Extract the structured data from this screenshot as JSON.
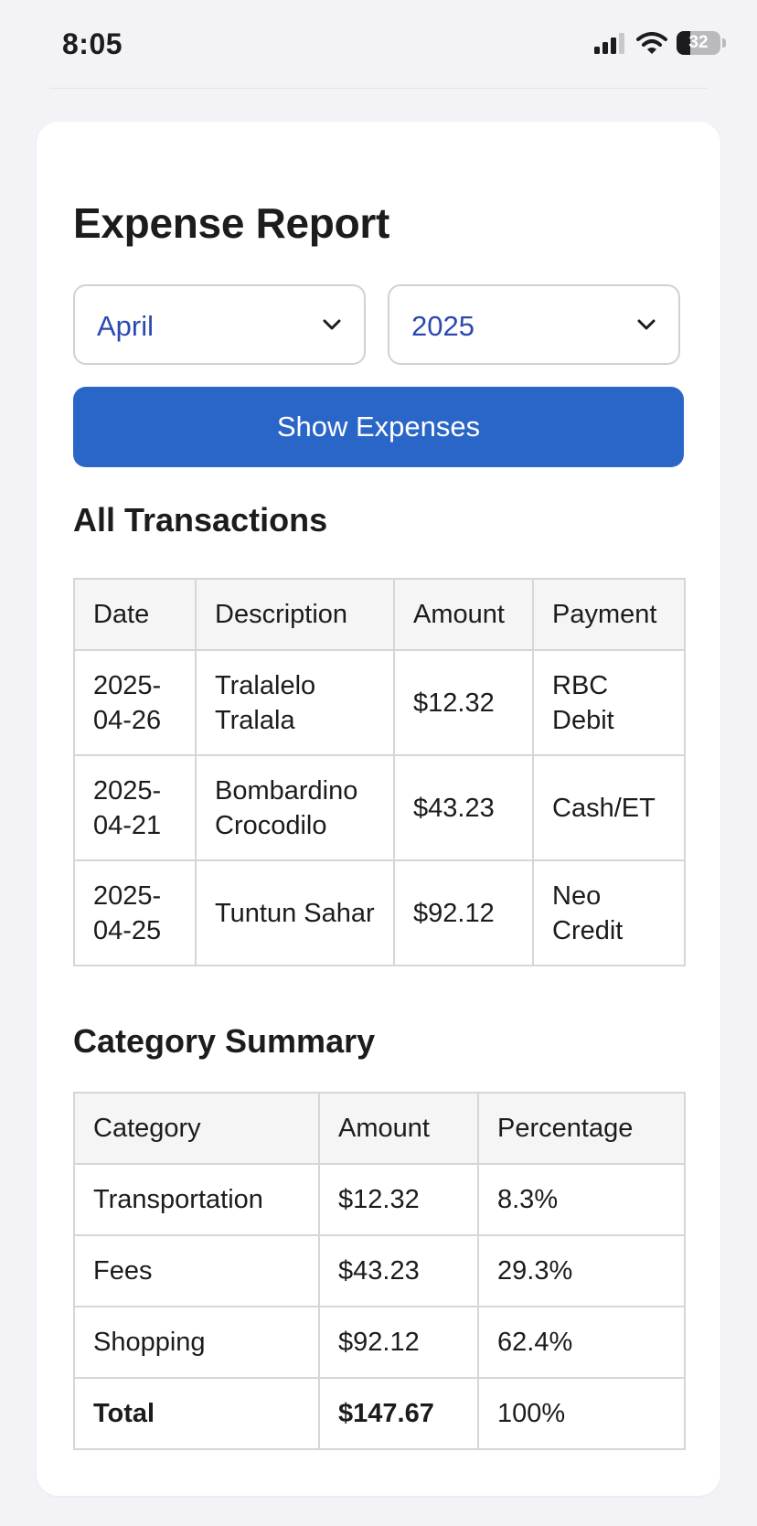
{
  "status_bar": {
    "time": "8:05",
    "battery": "32",
    "battery_level": 0.32
  },
  "report": {
    "title": "Expense Report",
    "month_select": {
      "value": "April"
    },
    "year_select": {
      "value": "2025"
    },
    "show_button": "Show Expenses"
  },
  "transactions": {
    "title": "All Transactions",
    "headers": [
      "Date",
      "Description",
      "Amount",
      "Payment"
    ],
    "rows": [
      {
        "date": "2025-04-26",
        "description": "Tralalelo Tralala",
        "amount": "$12.32",
        "payment": "RBC Debit"
      },
      {
        "date": "2025-04-21",
        "description": "Bombardino Crocodilo",
        "amount": "$43.23",
        "payment": "Cash/ET"
      },
      {
        "date": "2025-04-25",
        "description": "Tuntun Sahar",
        "amount": "$92.12",
        "payment": "Neo Credit"
      }
    ]
  },
  "summary": {
    "title": "Category Summary",
    "headers": [
      "Category",
      "Amount",
      "Percentage"
    ],
    "rows": [
      {
        "category": "Transportation",
        "amount": "$12.32",
        "percentage": "8.3%"
      },
      {
        "category": "Fees",
        "amount": "$43.23",
        "percentage": "29.3%"
      },
      {
        "category": "Shopping",
        "amount": "$92.12",
        "percentage": "62.4%"
      }
    ],
    "total": {
      "category": "Total",
      "amount": "$147.67",
      "percentage": "100%"
    }
  },
  "colors": {
    "accent": "#2a66c8",
    "select_text": "#2c49b0",
    "background": "#f2f2f7",
    "card": "#ffffff"
  },
  "icons": [
    "signal-icon",
    "wifi-icon",
    "battery-icon",
    "chevron-down-icon"
  ]
}
